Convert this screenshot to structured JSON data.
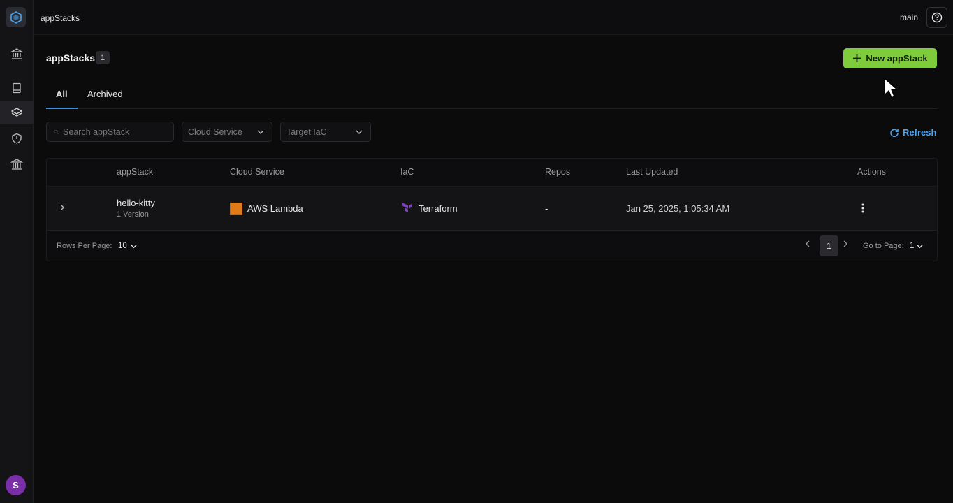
{
  "topbar": {
    "app_title": "appStacks",
    "branch": "main"
  },
  "sidebar": {
    "avatar_letter": "S",
    "icons": [
      "logo-icon",
      "bank-icon",
      "book-icon",
      "layers-icon",
      "shield-icon",
      "bank-icon"
    ]
  },
  "page": {
    "title": "appStacks",
    "count": "1",
    "new_button": "New appStack",
    "tabs": [
      {
        "label": "All"
      },
      {
        "label": "Archived"
      }
    ]
  },
  "filters": {
    "search_placeholder": "Search appStack",
    "cloud_service": "Cloud Service",
    "target_iac": "Target IaC",
    "refresh": "Refresh"
  },
  "table": {
    "columns": [
      "appStack",
      "Cloud Service",
      "IaC",
      "Repos",
      "Last Updated",
      "Actions"
    ],
    "rows": [
      {
        "name": "hello-kitty",
        "version": "1 Version",
        "cloud_service": "AWS Lambda",
        "iac": "Terraform",
        "repos": "-",
        "last_updated": "Jan 25, 2025, 1:05:34 AM"
      }
    ]
  },
  "pagination": {
    "rows_per_page_label": "Rows Per Page:",
    "rows_per_page": "10",
    "current_page": "1",
    "goto_label": "Go to Page:",
    "goto_value": "1"
  },
  "colors": {
    "accent_green": "#7ecb3b",
    "accent_blue": "#4aa3f0",
    "avatar": "#7a2ea8",
    "lambda": "#e07b1a",
    "terraform": "#7b42bc"
  }
}
